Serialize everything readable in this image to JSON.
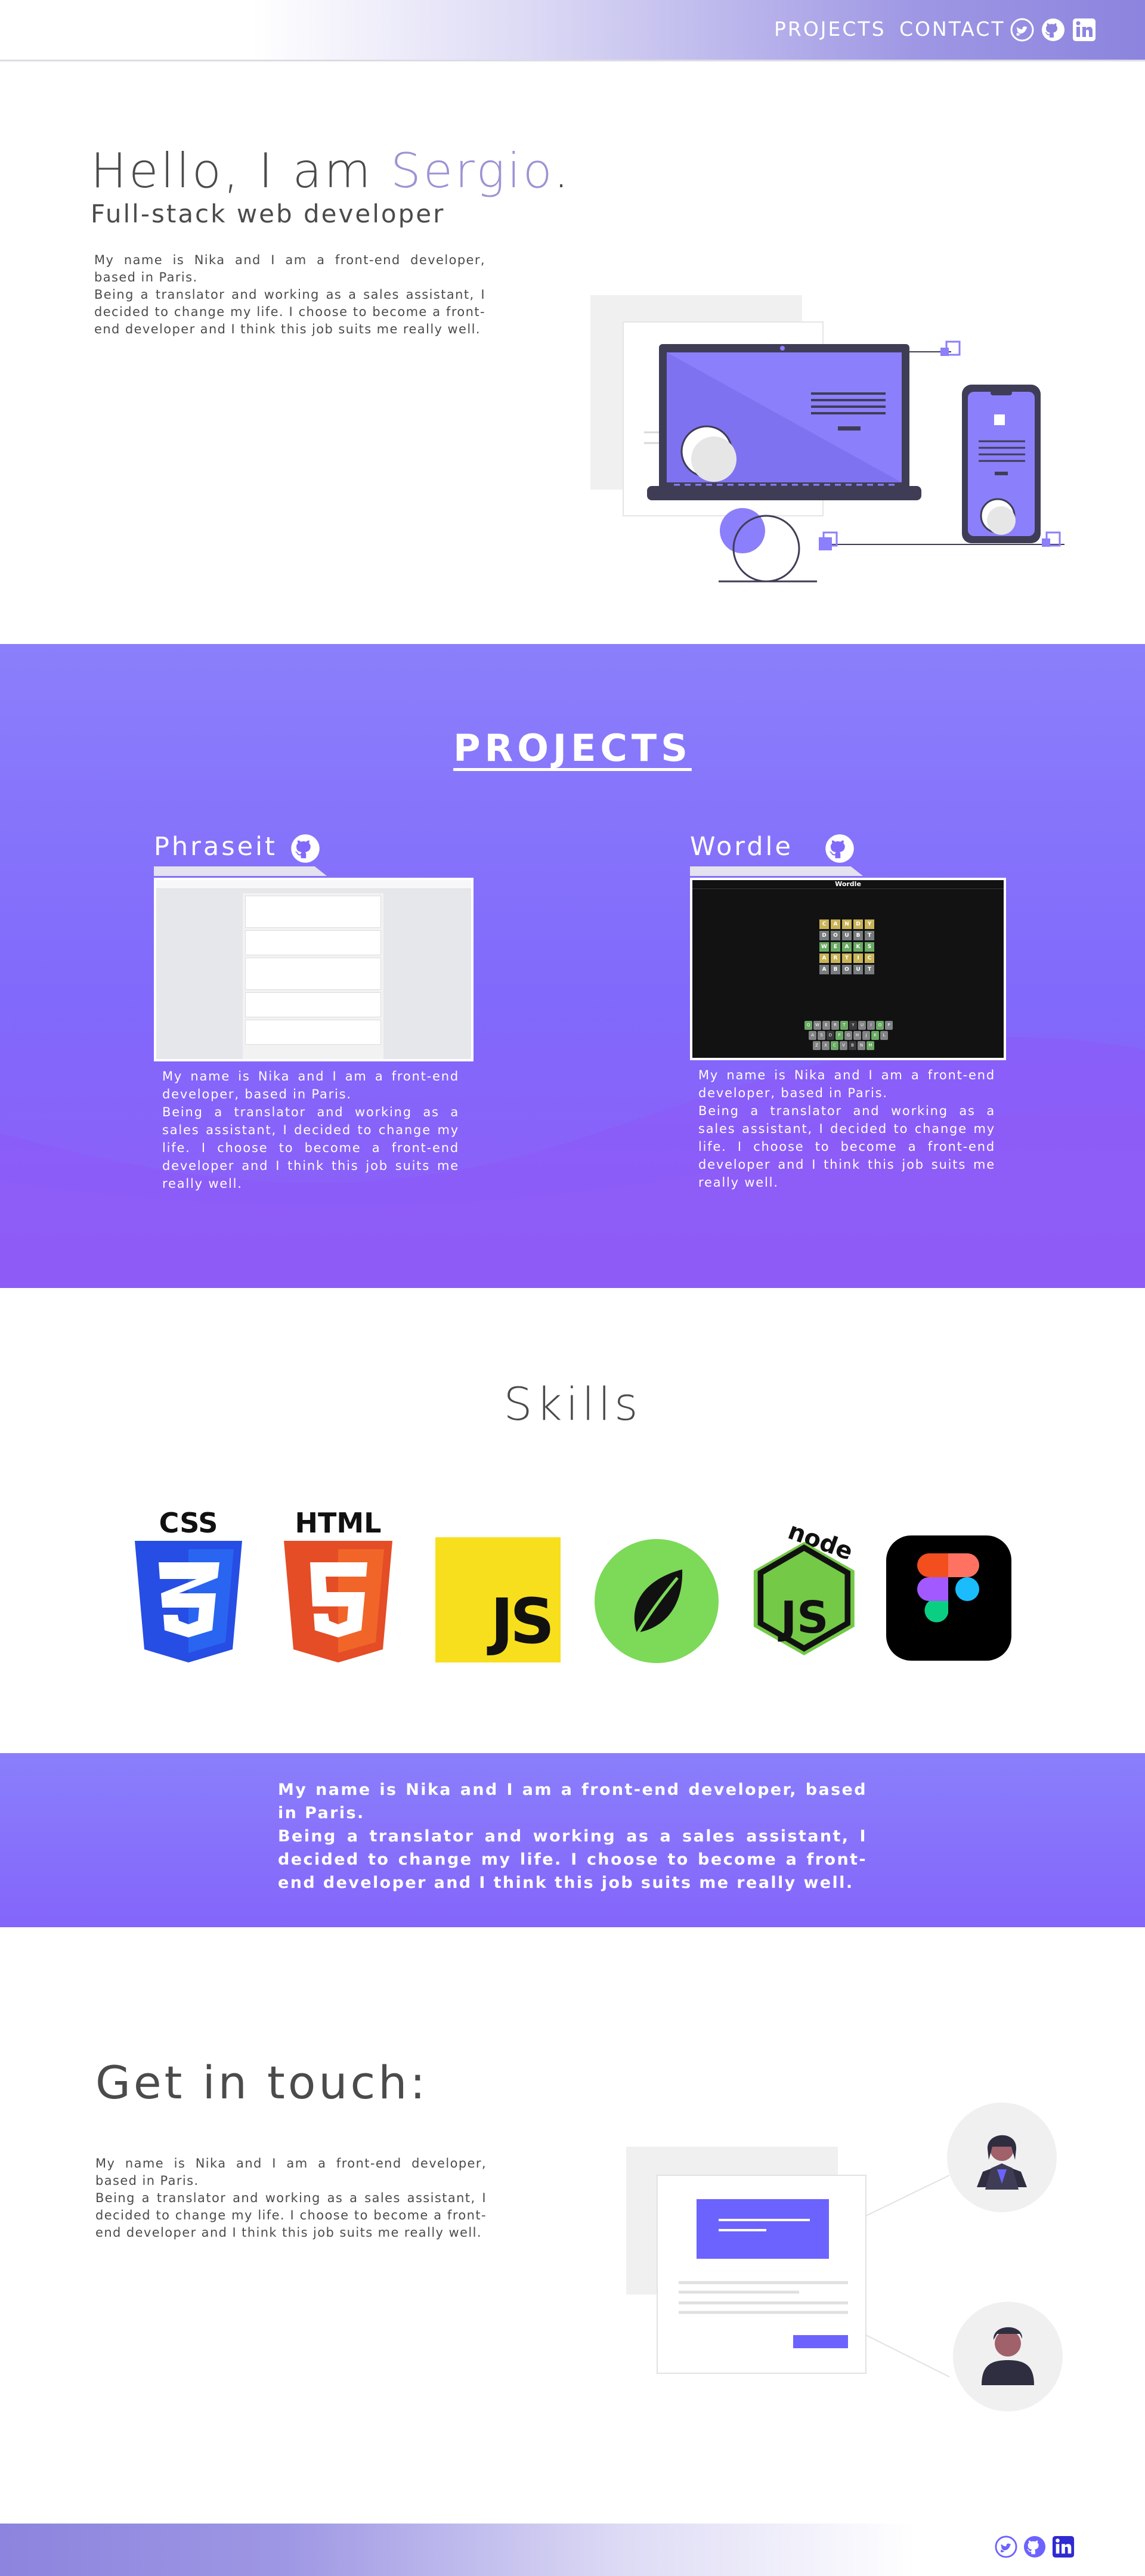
{
  "nav": {
    "links": [
      "PROJECTS",
      "CONTACT"
    ],
    "social_icons": [
      "twitter-icon",
      "github-icon",
      "linkedin-icon"
    ]
  },
  "hero": {
    "greeting": "Hello, I am ",
    "name": "Sergio",
    "dot": ".",
    "subtitle": "Full-stack web developer",
    "bio": "My name is Nika and I am a front-end developer, based in Paris.\nBeing a translator and working as a sales assistant, I decided to change my life. I choose to become a front-end developer and I think this job suits me really well."
  },
  "projects": {
    "title": "PROJECTS",
    "items": [
      {
        "name": "Phraseit",
        "description": "My name is Nika and I am a front-end developer, based in Paris.\nBeing a translator and working as a sales assistant, I decided to change my life. I choose to become a front-end developer and I think this job suits me really well."
      },
      {
        "name": "Wordle",
        "description": "My name is Nika and I am a front-end developer, based in Paris.\nBeing a translator and working as a sales assistant, I decided to change my life. I choose to become a front-end developer and I think this job suits me really well."
      }
    ],
    "wordle_heading": "Wordle",
    "wordle_rows": [
      "CANDY",
      "DOUBT",
      "WEAKS",
      "ARTIC",
      "ABOUT"
    ],
    "keyboard_rows": [
      "QWERTYUIOP",
      "ASDFGHJKL",
      "ZXCVBNM"
    ]
  },
  "skills": {
    "title": "Skills",
    "logos": [
      "CSS",
      "HTML",
      "JS",
      "node"
    ]
  },
  "band": {
    "text": "My name is Nika and I am a front-end developer, based in Paris.\nBeing a translator and working as a sales assistant, I decided to change my life. I choose to become a front-end developer and I think this job suits me really well."
  },
  "contact": {
    "title": "Get in touch:",
    "text": "My name is Nika and I am a front-end developer, based in Paris.\nBeing a translator and working as a sales assistant, I decided to change my life. I choose to become a front-end developer and I think this job suits me really well."
  },
  "colors": {
    "accent": "#8c7ffb",
    "accent_dark": "#6c63ff",
    "name_highlight": "#9c93d4",
    "text": "#4b4b4b"
  }
}
